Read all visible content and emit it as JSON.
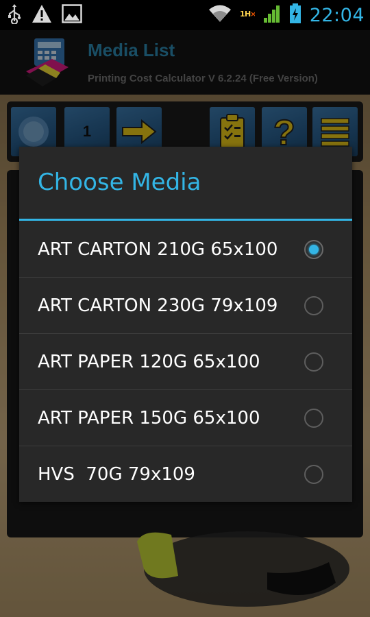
{
  "status_bar": {
    "time": "22:04",
    "left_icons": [
      "usb-icon",
      "warning-icon",
      "image-icon"
    ],
    "right_icons": [
      "wifi-icon",
      "sim-icon",
      "signal-icon",
      "battery-icon"
    ]
  },
  "app": {
    "title": "Media List",
    "subtitle": "Printing Cost Calculator V 6.2.24 (Free Version)",
    "toolbar": {
      "number_label": "1"
    }
  },
  "dialog": {
    "title": "Choose Media",
    "options": [
      {
        "label": "ART CARTON 210G 65x100",
        "checked": true
      },
      {
        "label": "ART CARTON 230G 79x109",
        "checked": false
      },
      {
        "label": "ART PAPER 120G 65x100",
        "checked": false
      },
      {
        "label": "ART PAPER 150G 65x100",
        "checked": false
      },
      {
        "label": "HVS  70G 79x109",
        "checked": false
      }
    ]
  },
  "colors": {
    "accent": "#33b5e5",
    "dialog_bg": "#282828",
    "app_title": "#2f8fb8"
  }
}
